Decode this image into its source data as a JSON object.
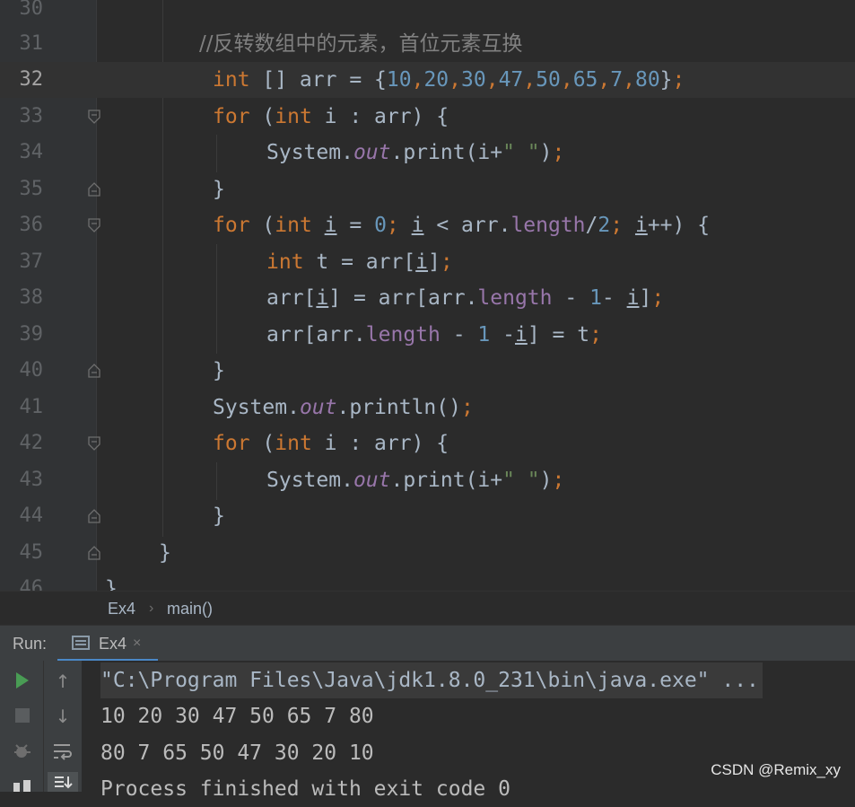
{
  "editor": {
    "current_line": 32,
    "lines": [
      {
        "n": "30"
      },
      {
        "n": "31"
      },
      {
        "n": "32"
      },
      {
        "n": "33"
      },
      {
        "n": "34"
      },
      {
        "n": "35"
      },
      {
        "n": "36"
      },
      {
        "n": "37"
      },
      {
        "n": "38"
      },
      {
        "n": "39"
      },
      {
        "n": "40"
      },
      {
        "n": "41"
      },
      {
        "n": "42"
      },
      {
        "n": "43"
      },
      {
        "n": "44"
      },
      {
        "n": "45"
      },
      {
        "n": "46"
      }
    ],
    "code": {
      "l31_comment": "//反转数组中的元素，首位元素互换",
      "l32": {
        "kw_int": "int",
        "decl": " [] arr = {",
        "nums": [
          "10",
          "20",
          "30",
          "47",
          "50",
          "65",
          "7",
          "80"
        ],
        "comma": ",",
        "close": "}",
        "semi": ";"
      },
      "l33": {
        "kw_for": "for",
        "p1": " (",
        "kw_int": "int",
        "rest": " i : arr) {"
      },
      "l34": {
        "sys": "System.",
        "out": "out",
        "print": ".print(i+",
        "str": "\" \"",
        "close": ")",
        "semi": ";"
      },
      "l35": "}",
      "l36": {
        "kw_for": "for",
        "p1": " (",
        "kw_int": "int",
        "sp": " ",
        "i": "i",
        "eq": " = ",
        "zero": "0",
        "semi": ";",
        "sp2": " ",
        "lt": " < arr.",
        "length": "length",
        "div": "/",
        "two": "2",
        "semi2": ";",
        "inc": "++) {"
      },
      "l37": {
        "kw_int": "int",
        "t": " t = arr[",
        "i": "i",
        "close": "]",
        "semi": ";"
      },
      "l38": {
        "a1": "arr[",
        "i": "i",
        "a2": "] = arr[arr.",
        "length": "length",
        "minus": " - ",
        "one": "1",
        "m2": "- ",
        "a3": "]",
        "semi": ";"
      },
      "l39": {
        "a1": "arr[arr.",
        "length": "length",
        "minus": " - ",
        "one": "1",
        "m2": " -",
        "i": "i",
        "a2": "] = t",
        "semi": ";"
      },
      "l40": "}",
      "l41": {
        "sys": "System.",
        "out": "out",
        "println": ".println()",
        "semi": ";"
      },
      "l42": {
        "kw_for": "for",
        "p1": " (",
        "kw_int": "int",
        "rest": " i : arr) {"
      },
      "l43": {
        "sys": "System.",
        "out": "out",
        "print": ".print(i+",
        "str": "\" \"",
        "close": ")",
        "semi": ";"
      },
      "l44": "}",
      "l45": "}",
      "l46": "}"
    }
  },
  "breadcrumb": {
    "class_name": "Ex4",
    "separator": "›",
    "method": "main()"
  },
  "run_panel": {
    "label": "Run:",
    "tab_label": "Ex4",
    "tab_close": "×",
    "console_lines": [
      "\"C:\\Program Files\\Java\\jdk1.8.0_231\\bin\\java.exe\" ...",
      "10 20 30 47 50 65 7 80",
      "80 7 65 50 47 30 20 10",
      "Process finished with exit code 0"
    ]
  },
  "watermark": "CSDN @Remix_xy",
  "colors": {
    "keyword": "#cc7832",
    "number": "#6897bb",
    "string": "#6a8759",
    "field": "#9876aa",
    "comment": "#808080",
    "run_green": "#499c54"
  }
}
